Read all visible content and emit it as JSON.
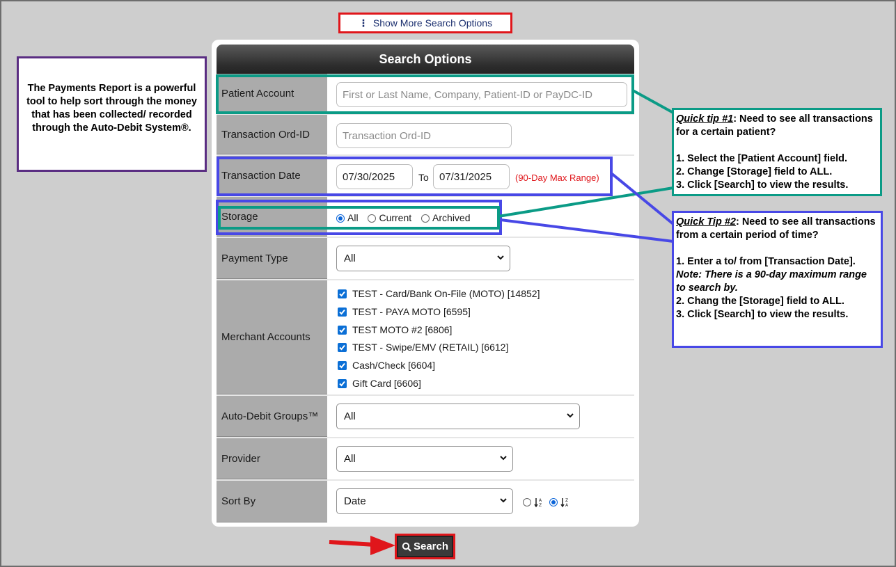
{
  "show_more": {
    "label": "Show More Search Options"
  },
  "left_note": {
    "text": "The Payments Report is a powerful tool to help sort through the money that has been collected/ recorded through the Auto-Debit System®."
  },
  "panel": {
    "title": "Search Options",
    "patient_account": {
      "label": "Patient Account",
      "placeholder": "First or Last Name, Company, Patient-ID or PayDC-ID"
    },
    "transaction_ord": {
      "label": "Transaction Ord-ID",
      "placeholder": "Transaction Ord-ID"
    },
    "transaction_date": {
      "label": "Transaction Date",
      "from": "07/30/2025",
      "to_label": "To",
      "to": "07/31/2025",
      "range_note": "(90-Day Max Range)"
    },
    "storage": {
      "label": "Storage",
      "options": [
        "All",
        "Current",
        "Archived"
      ],
      "selected": "All"
    },
    "payment_type": {
      "label": "Payment Type",
      "value": "All"
    },
    "merchant_accounts": {
      "label": "Merchant Accounts",
      "items": [
        "TEST - Card/Bank On-File (MOTO) [14852]",
        "TEST - PAYA MOTO [6595]",
        "TEST MOTO #2 [6806]",
        "TEST - Swipe/EMV (RETAIL) [6612]",
        "Cash/Check [6604]",
        "Gift Card [6606]"
      ]
    },
    "auto_debit_groups": {
      "label": "Auto-Debit Groups™",
      "value": "All"
    },
    "provider": {
      "label": "Provider",
      "value": "All"
    },
    "sort_by": {
      "label": "Sort By",
      "value": "Date"
    }
  },
  "search_button": {
    "label": "Search"
  },
  "tip1": {
    "title": "Quick tip #1",
    "intro": ": Need to see all transactions for a certain patient?",
    "steps": [
      "1. Select the [Patient Account] field.",
      "2. Change [Storage] field to ALL.",
      "3. Click [Search] to view the results."
    ]
  },
  "tip2": {
    "title": "Quick Tip #2",
    "intro": ": Need to see all transactions from a certain period of time?",
    "step1": "1. Enter a to/ from [Transaction Date].",
    "note": "Note: There is a 90-day maximum range to search by.",
    "step2": "2. Chang the [Storage] field to ALL.",
    "step3": "3. Click [Search] to view the results."
  },
  "colors": {
    "teal": "#0b9b86",
    "blue": "#4848e6",
    "red": "#e0161b",
    "purple": "#5a2d82"
  }
}
